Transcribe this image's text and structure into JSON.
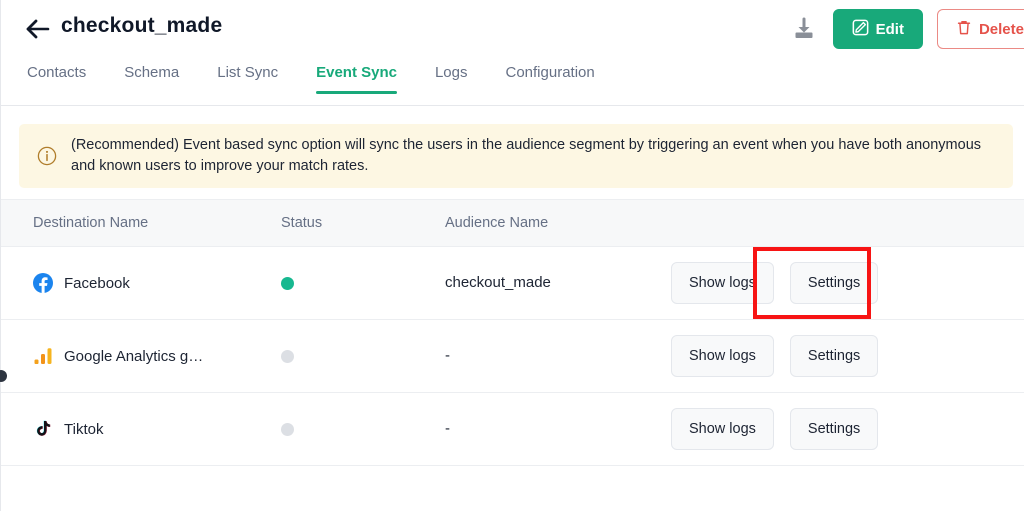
{
  "header": {
    "back_icon": "arrow-left-icon",
    "title": "checkout_made",
    "download_icon": "download-icon",
    "edit_label": "Edit",
    "edit_icon": "edit-pencil-icon",
    "delete_label": "Delete",
    "delete_icon": "trash-icon",
    "edit_color": "#18a97a",
    "delete_color": "#e5534b"
  },
  "tabs": {
    "items": [
      {
        "label": "Contacts",
        "active": false
      },
      {
        "label": "Schema",
        "active": false
      },
      {
        "label": "List Sync",
        "active": false
      },
      {
        "label": "Event Sync",
        "active": true
      },
      {
        "label": "Logs",
        "active": false
      },
      {
        "label": "Configuration",
        "active": false
      }
    ],
    "active_color": "#18a97a"
  },
  "banner": {
    "icon": "info-circle-icon",
    "text": "(Recommended) Event based sync option will sync the users in the audience segment by triggering an event when you have both anonymous and known users to improve your match rates.",
    "background": "#fdf7e3",
    "icon_color": "#b07d2b"
  },
  "table": {
    "columns": [
      "Destination Name",
      "Status",
      "Audience Name"
    ],
    "rows": [
      {
        "icon": "facebook-icon",
        "name": "Facebook",
        "status": "active",
        "audience": "checkout_made",
        "show_logs_label": "Show logs",
        "settings_label": "Settings"
      },
      {
        "icon": "google-analytics-icon",
        "name": "Google Analytics g…",
        "status": "idle",
        "audience": "-",
        "show_logs_label": "Show logs",
        "settings_label": "Settings"
      },
      {
        "icon": "tiktok-icon",
        "name": "Tiktok",
        "status": "idle",
        "audience": "-",
        "show_logs_label": "Show logs",
        "settings_label": "Settings"
      }
    ],
    "status_active_color": "#17b890",
    "status_idle_color": "#dcdfe4"
  },
  "annotation": {
    "target": "settings-button-row-1",
    "color": "#f71414"
  }
}
